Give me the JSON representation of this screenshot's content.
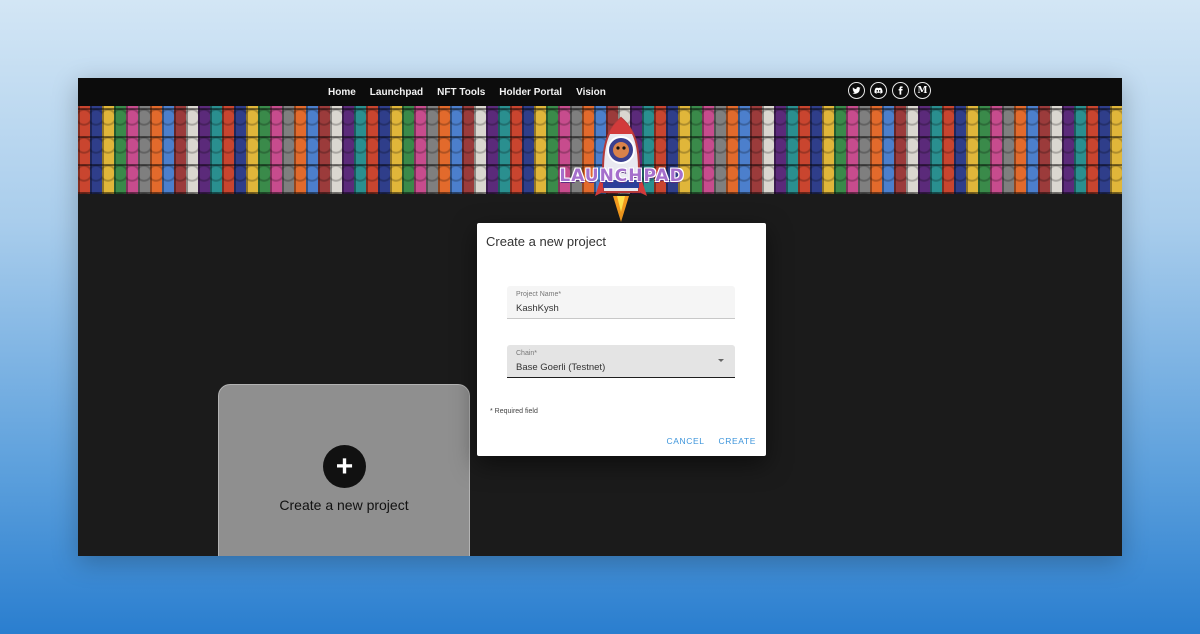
{
  "nav": {
    "links": [
      "Home",
      "Launchpad",
      "NFT Tools",
      "Holder Portal",
      "Vision"
    ],
    "social_icons": [
      "twitter-icon",
      "discord-icon",
      "facebook-icon",
      "medium-icon"
    ],
    "medium_glyph": "M"
  },
  "banner": {
    "logo_text": "LAUNCHPAD"
  },
  "project_card": {
    "icon": "plus-icon",
    "plus_glyph": "+",
    "label": "Create a new project"
  },
  "dialog": {
    "title": "Create a new project",
    "project_name": {
      "label": "Project Name*",
      "value": "KashKysh"
    },
    "chain": {
      "label": "Chain*",
      "value": "Base Goerli (Testnet)"
    },
    "required_note": "* Required field",
    "cancel_label": "CANCEL",
    "create_label": "CREATE"
  },
  "colors": {
    "page_bg": "#1b1b1b",
    "accent": "#3d95db",
    "card_bg": "#8f8f8f"
  }
}
